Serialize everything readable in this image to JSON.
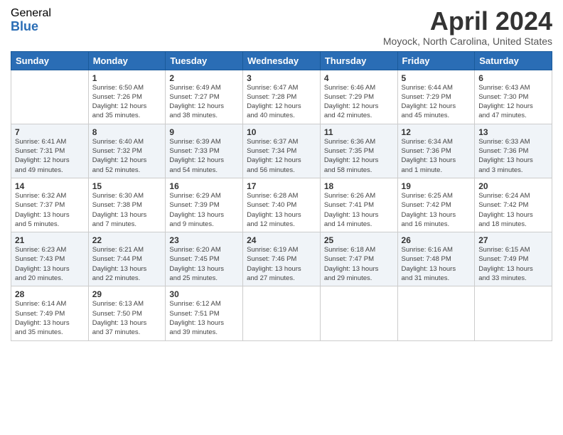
{
  "logo": {
    "general": "General",
    "blue": "Blue"
  },
  "title": "April 2024",
  "location": "Moyock, North Carolina, United States",
  "days_header": [
    "Sunday",
    "Monday",
    "Tuesday",
    "Wednesday",
    "Thursday",
    "Friday",
    "Saturday"
  ],
  "weeks": [
    [
      {
        "day": "",
        "info": ""
      },
      {
        "day": "1",
        "info": "Sunrise: 6:50 AM\nSunset: 7:26 PM\nDaylight: 12 hours\nand 35 minutes."
      },
      {
        "day": "2",
        "info": "Sunrise: 6:49 AM\nSunset: 7:27 PM\nDaylight: 12 hours\nand 38 minutes."
      },
      {
        "day": "3",
        "info": "Sunrise: 6:47 AM\nSunset: 7:28 PM\nDaylight: 12 hours\nand 40 minutes."
      },
      {
        "day": "4",
        "info": "Sunrise: 6:46 AM\nSunset: 7:29 PM\nDaylight: 12 hours\nand 42 minutes."
      },
      {
        "day": "5",
        "info": "Sunrise: 6:44 AM\nSunset: 7:29 PM\nDaylight: 12 hours\nand 45 minutes."
      },
      {
        "day": "6",
        "info": "Sunrise: 6:43 AM\nSunset: 7:30 PM\nDaylight: 12 hours\nand 47 minutes."
      }
    ],
    [
      {
        "day": "7",
        "info": "Sunrise: 6:41 AM\nSunset: 7:31 PM\nDaylight: 12 hours\nand 49 minutes."
      },
      {
        "day": "8",
        "info": "Sunrise: 6:40 AM\nSunset: 7:32 PM\nDaylight: 12 hours\nand 52 minutes."
      },
      {
        "day": "9",
        "info": "Sunrise: 6:39 AM\nSunset: 7:33 PM\nDaylight: 12 hours\nand 54 minutes."
      },
      {
        "day": "10",
        "info": "Sunrise: 6:37 AM\nSunset: 7:34 PM\nDaylight: 12 hours\nand 56 minutes."
      },
      {
        "day": "11",
        "info": "Sunrise: 6:36 AM\nSunset: 7:35 PM\nDaylight: 12 hours\nand 58 minutes."
      },
      {
        "day": "12",
        "info": "Sunrise: 6:34 AM\nSunset: 7:36 PM\nDaylight: 13 hours\nand 1 minute."
      },
      {
        "day": "13",
        "info": "Sunrise: 6:33 AM\nSunset: 7:36 PM\nDaylight: 13 hours\nand 3 minutes."
      }
    ],
    [
      {
        "day": "14",
        "info": "Sunrise: 6:32 AM\nSunset: 7:37 PM\nDaylight: 13 hours\nand 5 minutes."
      },
      {
        "day": "15",
        "info": "Sunrise: 6:30 AM\nSunset: 7:38 PM\nDaylight: 13 hours\nand 7 minutes."
      },
      {
        "day": "16",
        "info": "Sunrise: 6:29 AM\nSunset: 7:39 PM\nDaylight: 13 hours\nand 9 minutes."
      },
      {
        "day": "17",
        "info": "Sunrise: 6:28 AM\nSunset: 7:40 PM\nDaylight: 13 hours\nand 12 minutes."
      },
      {
        "day": "18",
        "info": "Sunrise: 6:26 AM\nSunset: 7:41 PM\nDaylight: 13 hours\nand 14 minutes."
      },
      {
        "day": "19",
        "info": "Sunrise: 6:25 AM\nSunset: 7:42 PM\nDaylight: 13 hours\nand 16 minutes."
      },
      {
        "day": "20",
        "info": "Sunrise: 6:24 AM\nSunset: 7:42 PM\nDaylight: 13 hours\nand 18 minutes."
      }
    ],
    [
      {
        "day": "21",
        "info": "Sunrise: 6:23 AM\nSunset: 7:43 PM\nDaylight: 13 hours\nand 20 minutes."
      },
      {
        "day": "22",
        "info": "Sunrise: 6:21 AM\nSunset: 7:44 PM\nDaylight: 13 hours\nand 22 minutes."
      },
      {
        "day": "23",
        "info": "Sunrise: 6:20 AM\nSunset: 7:45 PM\nDaylight: 13 hours\nand 25 minutes."
      },
      {
        "day": "24",
        "info": "Sunrise: 6:19 AM\nSunset: 7:46 PM\nDaylight: 13 hours\nand 27 minutes."
      },
      {
        "day": "25",
        "info": "Sunrise: 6:18 AM\nSunset: 7:47 PM\nDaylight: 13 hours\nand 29 minutes."
      },
      {
        "day": "26",
        "info": "Sunrise: 6:16 AM\nSunset: 7:48 PM\nDaylight: 13 hours\nand 31 minutes."
      },
      {
        "day": "27",
        "info": "Sunrise: 6:15 AM\nSunset: 7:49 PM\nDaylight: 13 hours\nand 33 minutes."
      }
    ],
    [
      {
        "day": "28",
        "info": "Sunrise: 6:14 AM\nSunset: 7:49 PM\nDaylight: 13 hours\nand 35 minutes."
      },
      {
        "day": "29",
        "info": "Sunrise: 6:13 AM\nSunset: 7:50 PM\nDaylight: 13 hours\nand 37 minutes."
      },
      {
        "day": "30",
        "info": "Sunrise: 6:12 AM\nSunset: 7:51 PM\nDaylight: 13 hours\nand 39 minutes."
      },
      {
        "day": "",
        "info": ""
      },
      {
        "day": "",
        "info": ""
      },
      {
        "day": "",
        "info": ""
      },
      {
        "day": "",
        "info": ""
      }
    ]
  ]
}
